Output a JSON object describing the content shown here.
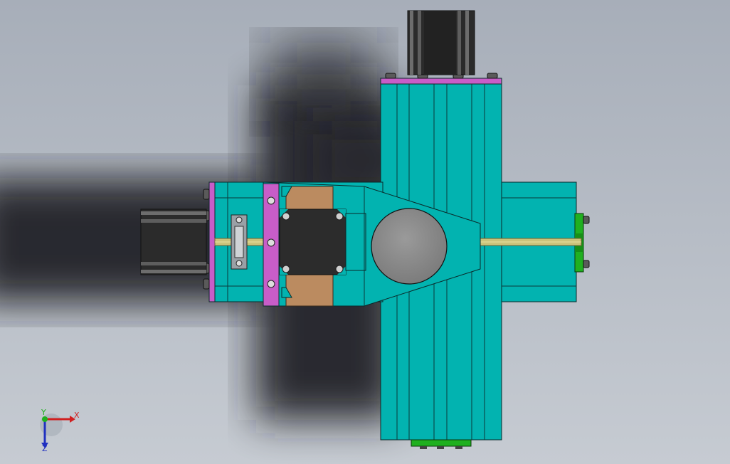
{
  "viewport": {
    "background_top": "#a9b0bb",
    "background_bottom": "#c4c9d1"
  },
  "colors": {
    "frame": "#02b3b0",
    "frame_dark": "#019b98",
    "magenta": "#c85dc8",
    "motor": "#2a2a2a",
    "motor_highlight": "#6a6a6a",
    "bronze": "#bb8b60",
    "shaft": "#c9c27a",
    "green_bracket": "#22b022",
    "disk": "#8a8a8a",
    "outline": "#0a2a2a",
    "shadow": "#1c1e22"
  },
  "triad": {
    "x_label": "X",
    "y_label": "Y",
    "z_label": "Z",
    "x_color": "#d02020",
    "y_color": "#20b020",
    "z_color": "#2030c0"
  }
}
